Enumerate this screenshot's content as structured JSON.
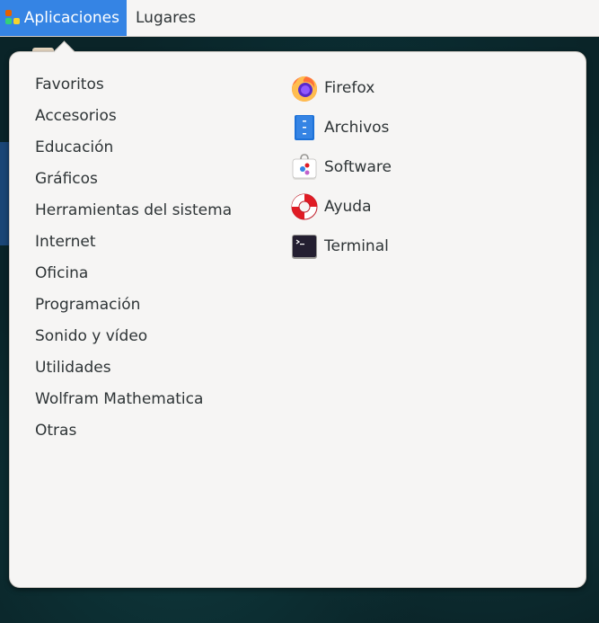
{
  "topbar": {
    "applications_label": "Aplicaciones",
    "places_label": "Lugares",
    "accent": "#3584e4"
  },
  "categories": [
    {
      "label": "Favoritos"
    },
    {
      "label": "Accesorios"
    },
    {
      "label": "Educación"
    },
    {
      "label": "Gráficos"
    },
    {
      "label": "Herramientas del sistema"
    },
    {
      "label": "Internet"
    },
    {
      "label": "Oficina"
    },
    {
      "label": "Programación"
    },
    {
      "label": "Sonido y vídeo"
    },
    {
      "label": "Utilidades"
    },
    {
      "label": "Wolfram Mathematica"
    },
    {
      "label": "Otras"
    }
  ],
  "apps": [
    {
      "label": "Firefox",
      "icon": "firefox-icon"
    },
    {
      "label": "Archivos",
      "icon": "files-icon"
    },
    {
      "label": "Software",
      "icon": "software-icon"
    },
    {
      "label": "Ayuda",
      "icon": "help-lifebuoy-icon"
    },
    {
      "label": "Terminal",
      "icon": "terminal-icon"
    }
  ]
}
